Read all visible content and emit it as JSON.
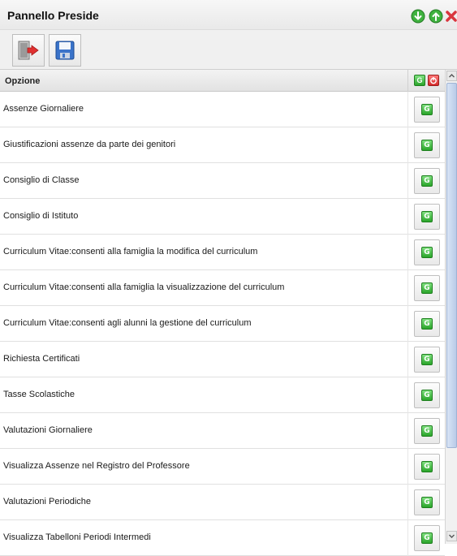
{
  "window": {
    "title": "Pannello Preside",
    "controls": [
      {
        "name": "move-down",
        "icon": "arrow-down-icon",
        "color": "#3fb23f"
      },
      {
        "name": "move-up",
        "icon": "arrow-up-icon",
        "color": "#3fb23f"
      },
      {
        "name": "close",
        "icon": "close-icon",
        "color": "#d9363e"
      }
    ]
  },
  "toolbar": {
    "buttons": [
      {
        "name": "exit",
        "icon": "exit-door-icon"
      },
      {
        "name": "save",
        "icon": "floppy-disk-icon"
      }
    ]
  },
  "grid": {
    "columns": [
      "Opzione"
    ],
    "header_icons": [
      {
        "name": "grant-all",
        "icon": "g-green-icon",
        "color": "#2aa52a"
      },
      {
        "name": "reset-all",
        "icon": "power-red-icon",
        "color": "#e03535"
      }
    ],
    "button_glyph": "G",
    "rows": [
      {
        "label": "Assenze Giornaliere"
      },
      {
        "label": "Giustificazioni assenze da parte dei genitori"
      },
      {
        "label": "Consiglio di Classe"
      },
      {
        "label": "Consiglio di Istituto"
      },
      {
        "label": "Curriculum Vitae:consenti alla famiglia la modifica del curriculum"
      },
      {
        "label": "Curriculum Vitae:consenti alla famiglia la visualizzazione del curriculum"
      },
      {
        "label": "Curriculum Vitae:consenti agli alunni la gestione del curriculum"
      },
      {
        "label": "Richiesta Certificati"
      },
      {
        "label": "Tasse Scolastiche"
      },
      {
        "label": "Valutazioni Giornaliere"
      },
      {
        "label": "Visualizza Assenze nel Registro del Professore"
      },
      {
        "label": "Valutazioni Periodiche"
      },
      {
        "label": "Visualizza Tabelloni Periodi Intermedi"
      }
    ]
  },
  "colors": {
    "accent_green": "#2aa52a",
    "scroll_thumb": "#b9cbe8"
  }
}
